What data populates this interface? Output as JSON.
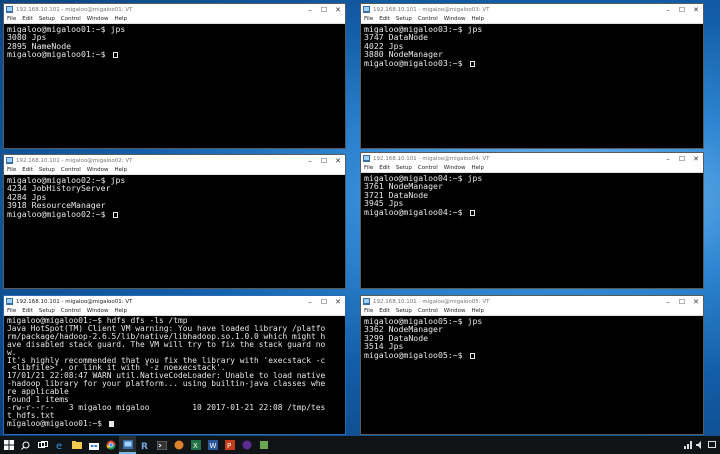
{
  "windows": [
    {
      "title": "192.168.10.101 - migaloo@migaloo01: VT",
      "lines": [
        "migaloo@migaloo01:~$ jps",
        "3080 Jps",
        "2895 NameNode",
        "migaloo@migaloo01:~$ "
      ]
    },
    {
      "title": "192.168.10.101 - migaloo@migaloo03: VT",
      "lines": [
        "migaloo@migaloo03:~$ jps",
        "3747 DataNode",
        "4022 Jps",
        "3880 NodeManager",
        "migaloo@migaloo03:~$ "
      ]
    },
    {
      "title": "192.168.10.101 - migaloo@migaloo02: VT",
      "lines": [
        "migaloo@migaloo02:~$ jps",
        "4234 JobHistoryServer",
        "4284 Jps",
        "3918 ResourceManager",
        "migaloo@migaloo02:~$ "
      ]
    },
    {
      "title": "192.168.10.101 - migaloo@migaloo04: VT",
      "lines": [
        "migaloo@migaloo04:~$ jps",
        "3761 NodeManager",
        "3721 DataNode",
        "3945 Jps",
        "migaloo@migaloo04:~$ "
      ]
    },
    {
      "title": "192.168.10.101 - migaloo@migaloo01: VT",
      "lines": [
        "migaloo@migaloo01:~$ hdfs dfs -ls /tmp",
        "Java HotSpot(TM) Client VM warning: You have loaded library /platfo",
        "rm/package/hadoop-2.6.5/lib/native/libhadoop.so.1.0.0 which might h",
        "ave disabled stack guard. The VM will try to fix the stack guard no",
        "w.",
        "It's highly recommended that you fix the library with 'execstack -c",
        " <libfile>', or link it with '-z noexecstack'.",
        "17/01/21 22:08:47 WARN util.NativeCodeLoader: Unable to load native",
        "-hadoop library for your platform... using builtin-java classes whe",
        "re applicable",
        "Found 1 items",
        "-rw-r--r--   3 migaloo migaloo         10 2017-01-21 22:08 /tmp/tes",
        "t_hdfs.txt",
        "migaloo@migaloo01:~$ "
      ]
    },
    {
      "title": "192.168.10.101 - migaloo@migaloo05: VT",
      "lines": [
        "migaloo@migaloo05:~$ jps",
        "3362 NodeManager",
        "3299 DataNode",
        "3514 Jps",
        "migaloo@migaloo05:~$ "
      ]
    }
  ],
  "menu": [
    "File",
    "Edit",
    "Setup",
    "Control",
    "Window",
    "Help"
  ],
  "taskbar": {
    "items": [
      "start-icon",
      "search-icon",
      "task-view-icon",
      "edge-icon",
      "explorer-icon",
      "store-icon",
      "chrome-icon",
      "teraterm-icon",
      "r-icon",
      "terminal-icon",
      "app-icon",
      "app-icon-2",
      "app-icon-3",
      "app-icon-4",
      "app-icon-5",
      "app-icon-6"
    ]
  },
  "colors": {
    "terminal_bg": "#000000",
    "terminal_fg": "#e8e8e8",
    "taskbar": "#101417"
  }
}
